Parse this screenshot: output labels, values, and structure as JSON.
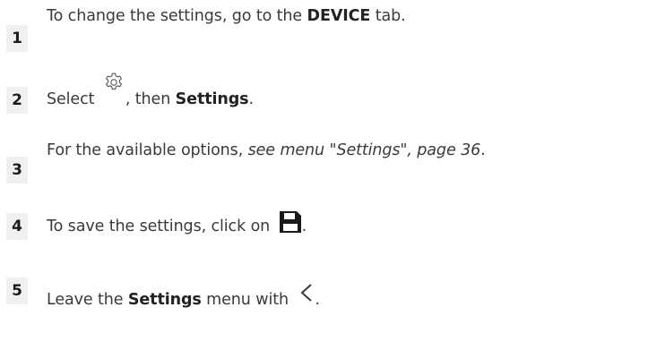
{
  "steps": [
    {
      "number": "1",
      "text_before": "To change the settings, go to the ",
      "bold": "DEVICE",
      "text_after": " tab."
    },
    {
      "number": "2",
      "text_before": "Select ",
      "icon": "gear-icon",
      "text_mid": ", then ",
      "bold": "Settings",
      "text_after": "."
    },
    {
      "number": "3",
      "text_before": "For the available options, ",
      "italic": "see menu \"Settings\", page 36",
      "text_after": "."
    },
    {
      "number": "4",
      "text_before": "To save the settings, click on ",
      "icon": "save-icon",
      "text_after": "."
    },
    {
      "number": "5",
      "text_before": "Leave the ",
      "bold": "Settings",
      "text_mid": " menu with ",
      "icon": "chevron-left-icon",
      "text_after": "."
    }
  ],
  "colors": {
    "text": "#3a3a3a",
    "number_background": "#f0f0f0",
    "number_text": "#1a1a1a"
  }
}
